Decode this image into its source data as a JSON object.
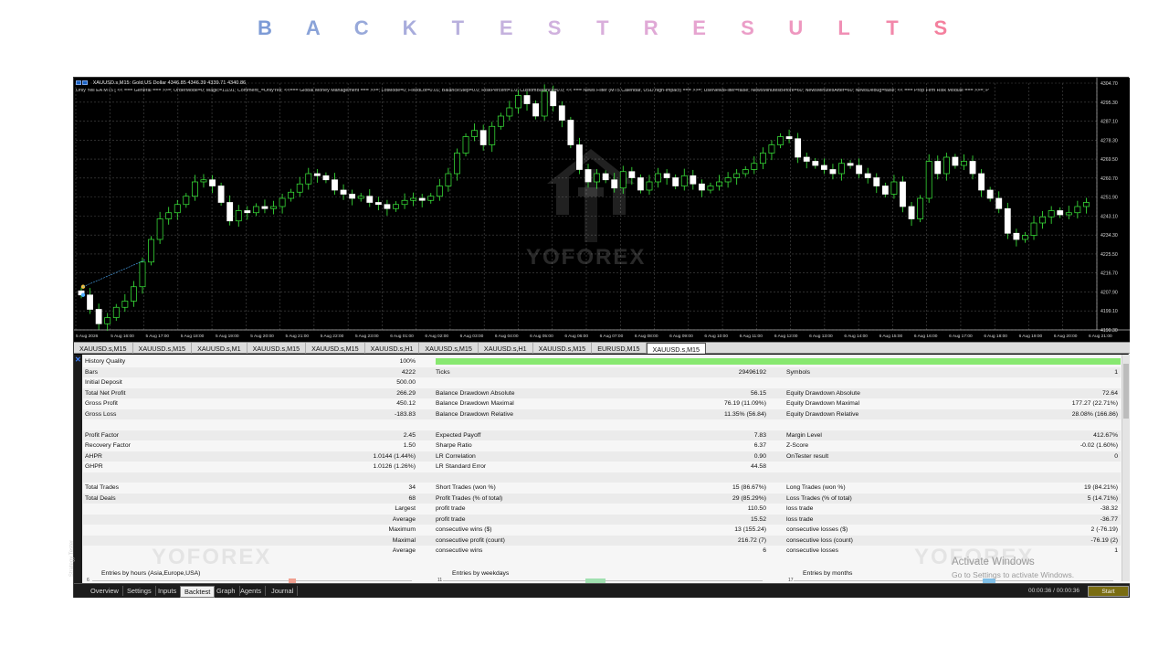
{
  "title": {
    "letters": [
      "B",
      "A",
      "C",
      "K",
      "T",
      "E",
      "S",
      "T",
      "R",
      "E",
      "S",
      "U",
      "L",
      "T",
      "S"
    ],
    "colors": [
      "#7d9bd6",
      "#8aa3d8",
      "#98a9da",
      "#a8acdc",
      "#b8b0dd",
      "#c5b2de",
      "#d0b1de",
      "#d9aedb",
      "#e0a9d6",
      "#e6a4d0",
      "#eb9ec8",
      "#ee97bf",
      "#f08fb5",
      "#f288aa",
      "#f4809e"
    ]
  },
  "chart": {
    "header": "XAUUSD.s,M15:  Gold US Dollar  4346.85 4346.39 4339.71 4340.86",
    "subheader": "Only Yell EA MT5 [ << === General === >>=; OrderMode=0; Magic=11191; Comment_=OnlyYell; <<=== Global Money Management === >>=; LotMode=0; FixedLot=0.01; BalanceStep=0.0; RiskPercent=1.0; CustomBalance=0.0; << === News Filter (MT5 Calendar, USD high-impact) === >>=; UseNewsFilter=false; NewsMinutesBefore=60; NewsMinutesAfter=60; NewsDebug=false; << === Prop Firm Risk Module === >>=; P",
    "watermark": "YOFOREX",
    "price_ticks": [
      "4304.70",
      "4295.30",
      "4287.10",
      "4278.30",
      "4269.50",
      "4260.70",
      "4251.90",
      "4243.10",
      "4234.30",
      "4225.50",
      "4216.70",
      "4207.90",
      "4199.10",
      "4190.30"
    ],
    "time_ticks": [
      "5 Aug 2026",
      "5 Aug 16:00",
      "5 Aug 17:00",
      "5 Aug 18:00",
      "5 Aug 19:00",
      "5 Aug 20:00",
      "5 Aug 21:00",
      "5 Aug 22:00",
      "5 Aug 23:00",
      "6 Aug 01:00",
      "6 Aug 02:00",
      "6 Aug 03:00",
      "6 Aug 04:00",
      "6 Aug 05:00",
      "6 Aug 06:00",
      "6 Aug 07:00",
      "6 Aug 08:00",
      "6 Aug 09:00",
      "6 Aug 10:00",
      "6 Aug 11:00",
      "6 Aug 12:00",
      "6 Aug 13:00",
      "6 Aug 14:00",
      "6 Aug 15:00",
      "6 Aug 16:00",
      "6 Aug 17:00",
      "6 Aug 18:00",
      "6 Aug 19:00",
      "6 Aug 20:00",
      "6 Aug 21:00"
    ],
    "closes": [
      4203,
      4196,
      4189,
      4192,
      4197,
      4200,
      4207,
      4219,
      4230,
      4240,
      4243,
      4247,
      4251,
      4258,
      4259,
      4256,
      4248,
      4239,
      4244,
      4243,
      4246,
      4245,
      4246,
      4250,
      4253,
      4257,
      4262,
      4261,
      4259,
      4254,
      4252,
      4250,
      4251,
      4248,
      4247,
      4245,
      4247,
      4249,
      4250,
      4249,
      4251,
      4256,
      4262,
      4272,
      4280,
      4283,
      4276,
      4285,
      4290,
      4294,
      4300,
      4296,
      4290,
      4302,
      4295,
      4288,
      4276,
      4264,
      4258,
      4262,
      4259,
      4255,
      4263,
      4260,
      4254,
      4258,
      4262,
      4260,
      4256,
      4261,
      4257,
      4254,
      4256,
      4258,
      4260,
      4262,
      4264,
      4267,
      4272,
      4276,
      4280,
      4279,
      4270,
      4268,
      4266,
      4264,
      4262,
      4267,
      4266,
      4262,
      4260,
      4256,
      4252,
      4258,
      4246,
      4240,
      4250,
      4268,
      4262,
      4270,
      4266,
      4268,
      4262,
      4254,
      4250,
      4245,
      4233,
      4230,
      4232,
      4238,
      4241,
      4244,
      4242,
      4243,
      4246,
      4248
    ]
  },
  "symbol_tabs": [
    "XAUUSD.s,M15",
    "XAUUSD.s,M15",
    "XAUUSD.s,M1",
    "XAUUSD.s,M15",
    "XAUUSD.s,M15",
    "XAUUSD.s,H1",
    "XAUUSD.s,M15",
    "XAUUSD.s,H1",
    "XAUUSD.s,M15",
    "EURUSD,M15",
    "XAUUSD.s,M15"
  ],
  "tester": {
    "side_label": "Strategy Tester",
    "history_quality": {
      "label": "History Quality",
      "value": "100%",
      "fraction": 1.0
    },
    "rows": [
      [
        "Bars",
        "4222",
        "Ticks",
        "29496192",
        "Symbols",
        "1"
      ],
      [
        "Initial Deposit",
        "500.00",
        "",
        "",
        "",
        ""
      ],
      [
        "Total Net Profit",
        "266.29",
        "Balance Drawdown Absolute",
        "56.15",
        "Equity Drawdown Absolute",
        "72.64"
      ],
      [
        "Gross Profit",
        "450.12",
        "Balance Drawdown Maximal",
        "76.19 (11.09%)",
        "Equity Drawdown Maximal",
        "177.27 (22.71%)"
      ],
      [
        "Gross Loss",
        "-183.83",
        "Balance Drawdown Relative",
        "11.35% (56.84)",
        "Equity Drawdown Relative",
        "28.08% (166.86)"
      ],
      [
        "",
        "",
        "",
        "",
        "",
        ""
      ],
      [
        "Profit Factor",
        "2.45",
        "Expected Payoff",
        "7.83",
        "Margin Level",
        "412.67%"
      ],
      [
        "Recovery Factor",
        "1.50",
        "Sharpe Ratio",
        "6.37",
        "Z-Score",
        "-0.02 (1.60%)"
      ],
      [
        "AHPR",
        "1.0144 (1.44%)",
        "LR Correlation",
        "0.90",
        "OnTester result",
        "0"
      ],
      [
        "GHPR",
        "1.0126 (1.26%)",
        "LR Standard Error",
        "44.58",
        "",
        ""
      ],
      [
        "",
        "",
        "",
        "",
        "",
        ""
      ],
      [
        "Total Trades",
        "34",
        "Short Trades (won %)",
        "15 (86.67%)",
        "Long Trades (won %)",
        "19 (84.21%)"
      ],
      [
        "Total Deals",
        "68",
        "Profit Trades (% of total)",
        "29 (85.29%)",
        "Loss Trades (% of total)",
        "5 (14.71%)"
      ],
      [
        "",
        "Largest",
        "profit trade",
        "110.50",
        "loss trade",
        "-38.32"
      ],
      [
        "",
        "Average",
        "profit trade",
        "15.52",
        "loss trade",
        "-36.77"
      ],
      [
        "",
        "Maximum",
        "consecutive wins ($)",
        "13 (155.24)",
        "consecutive losses ($)",
        "2 (-76.19)"
      ],
      [
        "",
        "Maximal",
        "consecutive profit (count)",
        "216.72 (7)",
        "consecutive loss (count)",
        "-76.19 (2)"
      ],
      [
        "",
        "Average",
        "consecutive wins",
        "6",
        "consecutive losses",
        "1"
      ]
    ],
    "mini_charts": [
      {
        "title": "Entries by hours (Asia,Europe,USA)",
        "tick": "6",
        "color": "#f0a090"
      },
      {
        "title": "Entries by weekdays",
        "tick": "11",
        "color": "#a0e0b0"
      },
      {
        "title": "Entries by months",
        "tick": "17",
        "color": "#80c0e8"
      }
    ]
  },
  "bottom_tabs": [
    "Overview",
    "Settings",
    "Inputs",
    "Backtest",
    "Graph",
    "Agents",
    "Journal"
  ],
  "timer": "00:00:36 / 00:00:36",
  "start_label": "Start",
  "activate_windows": {
    "line1": "Activate Windows",
    "line2": "Go to Settings to activate Windows."
  }
}
